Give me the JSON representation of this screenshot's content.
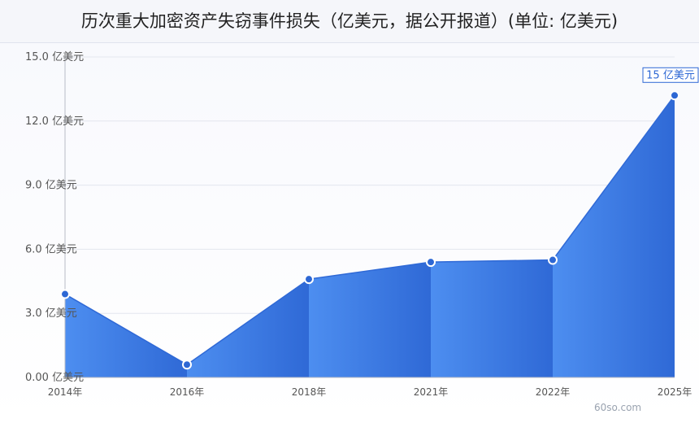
{
  "title": "历次重大加密资产失窃事件损失（亿美元，据公开报道）(单位: 亿美元)",
  "watermark": "60so.com",
  "colors": {
    "area_light": "#4d8ef0",
    "area_dark": "#2f69d6",
    "marker_fill": "#2d67d4",
    "grid": "#e3e6ee",
    "axis": "#b8bcc6",
    "label": "#555555",
    "annotation": "#2d67d4"
  },
  "chart_data": {
    "type": "area",
    "title": "历次重大加密资产失窃事件损失（亿美元，据公开报道）(单位: 亿美元)",
    "categories": [
      "2014年",
      "2016年",
      "2018年",
      "2021年",
      "2022年",
      "2025年"
    ],
    "series": [
      {
        "values": [
          3.9,
          0.6,
          4.6,
          5.4,
          5.5,
          13.2
        ]
      }
    ],
    "ylim": [
      0,
      15
    ],
    "y_ticks": [
      "0.00 亿美元",
      "3.0 亿美元",
      "6.0 亿美元",
      "9.0 亿美元",
      "12.0 亿美元",
      "15.0 亿美元"
    ],
    "y_tick_values": [
      0,
      3,
      6,
      9,
      12,
      15
    ],
    "annotation": {
      "category": "2025年",
      "text": "15 亿美元"
    },
    "grid": true,
    "legend": "none"
  }
}
